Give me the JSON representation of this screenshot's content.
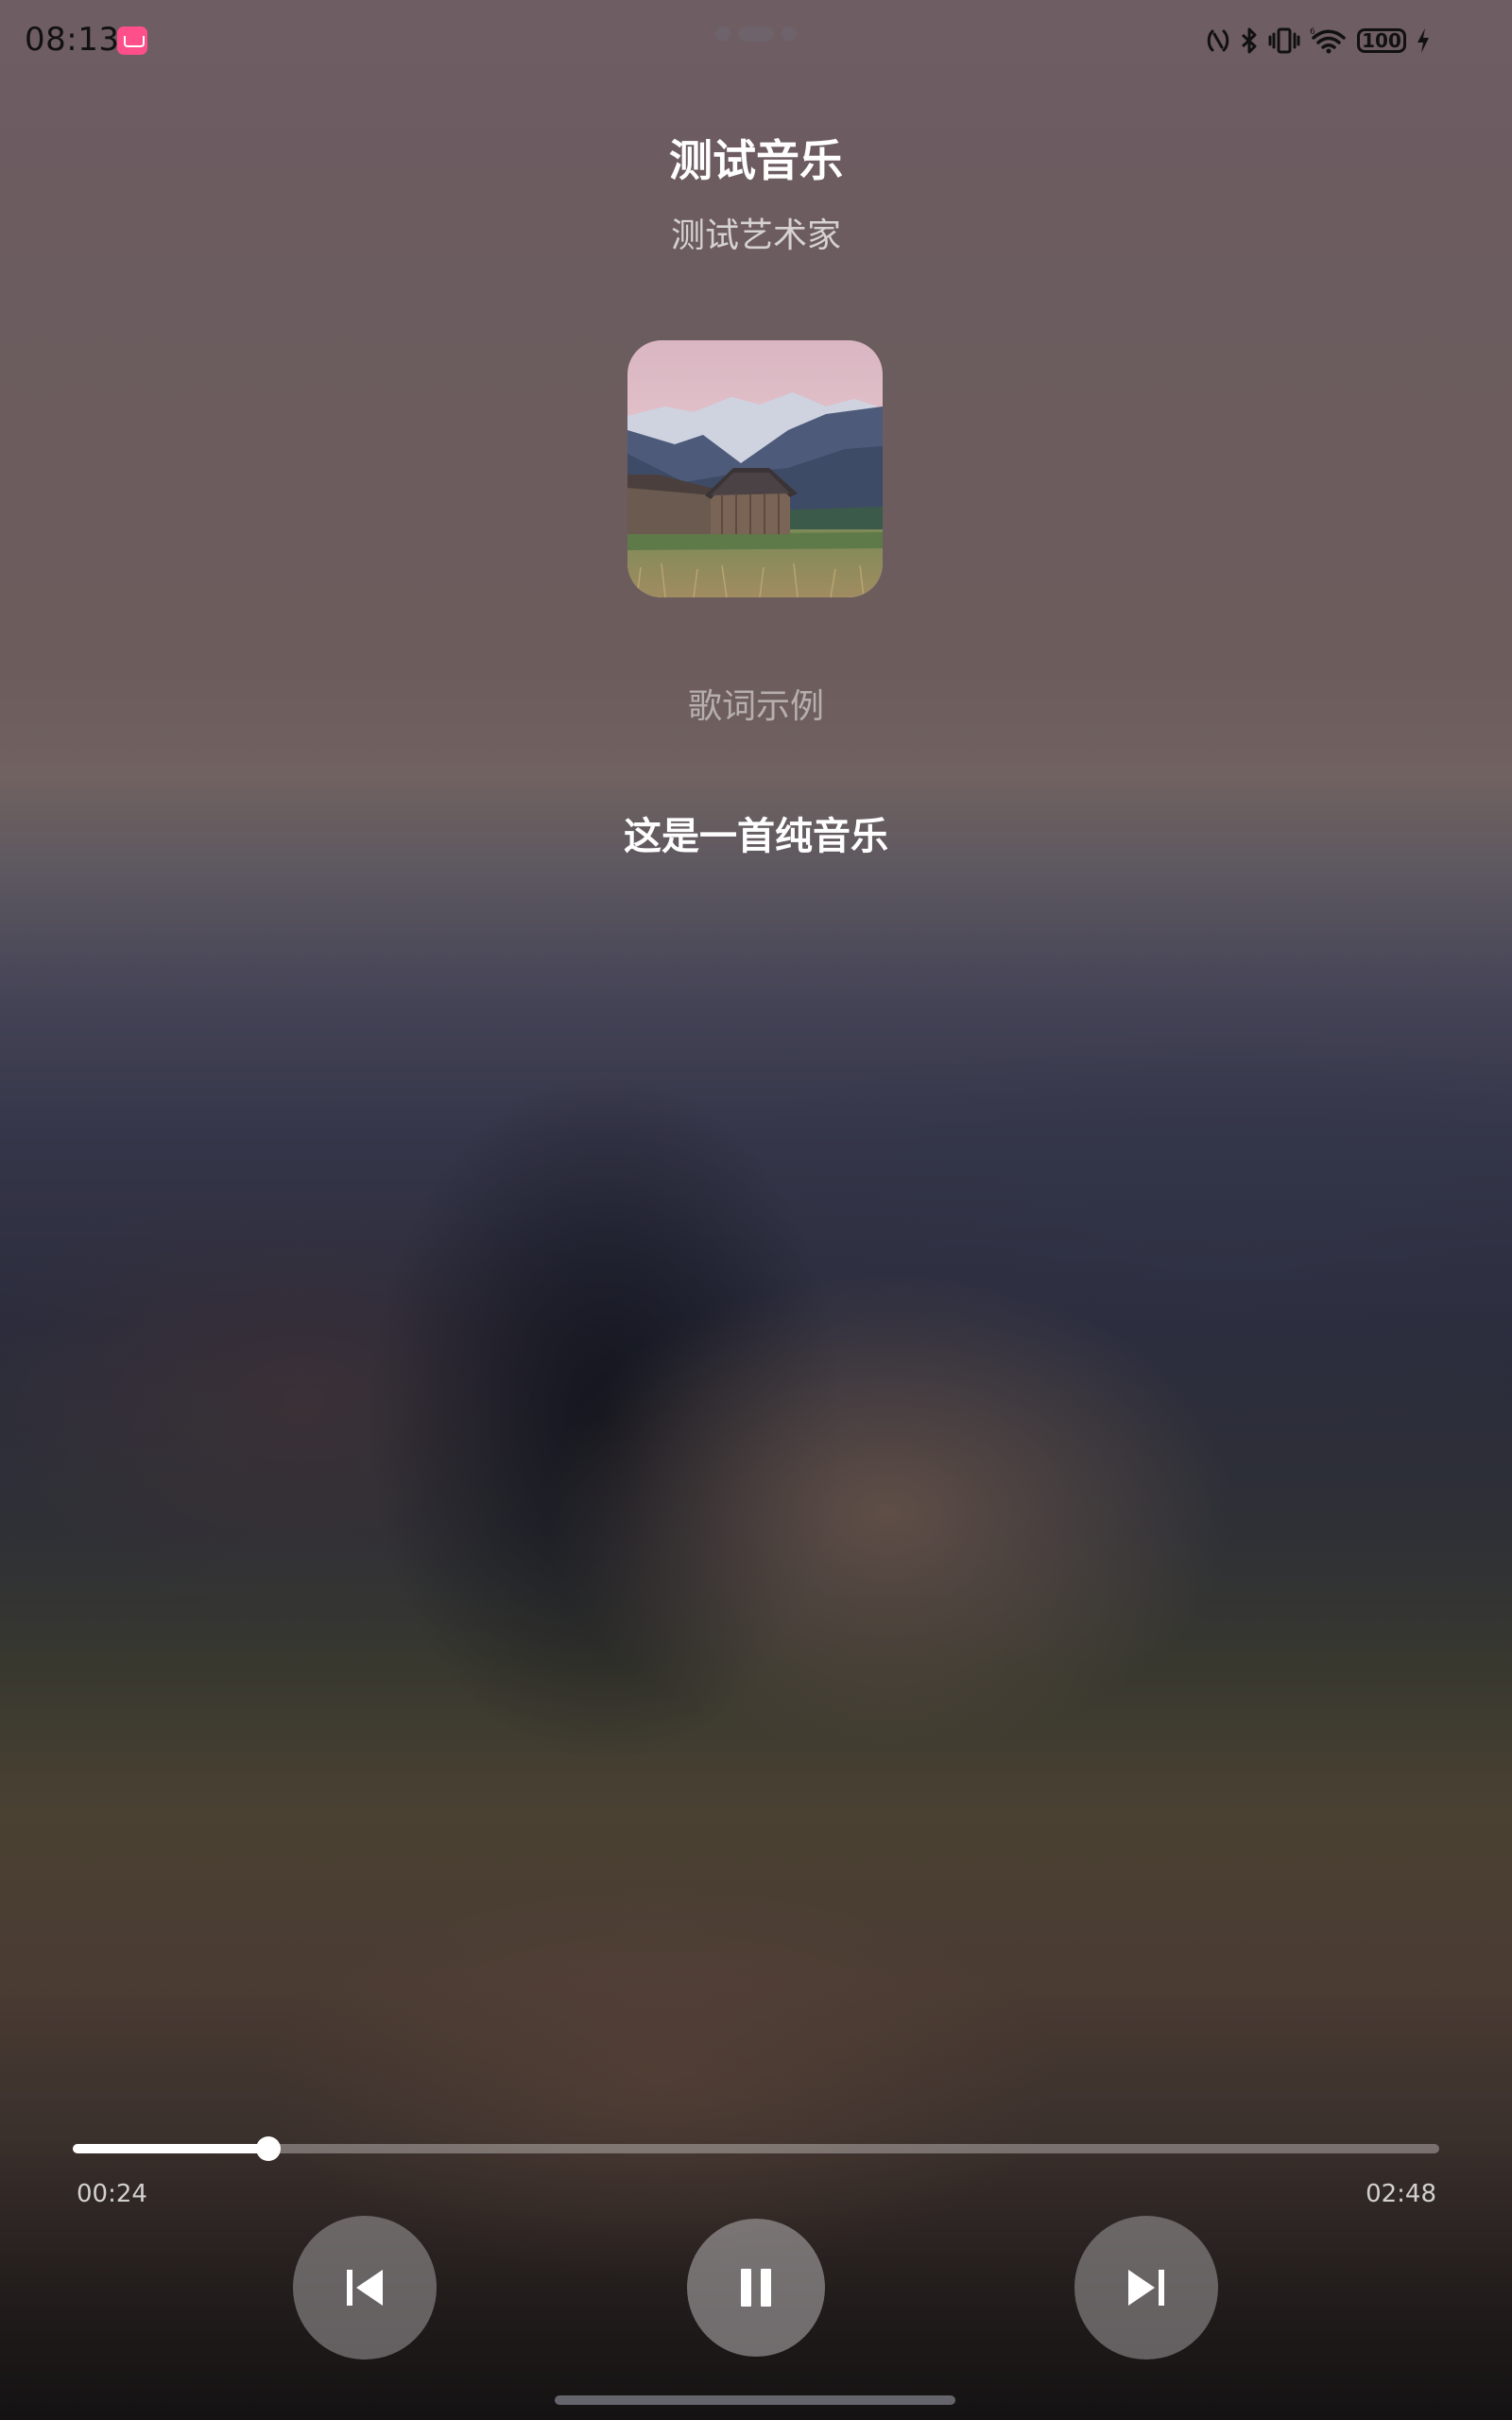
{
  "status_bar": {
    "time": "08:13",
    "app_icon": "app-badge-icon",
    "icons": [
      "nfc-icon",
      "bluetooth-icon",
      "vibrate-icon",
      "wifi-icon",
      "battery-icon",
      "charging-icon"
    ],
    "battery_level": "100"
  },
  "track": {
    "title": "测试音乐",
    "artist": "测试艺术家",
    "cover_icon": "album-cover-image"
  },
  "lyrics": {
    "sample_label": "歌词示例",
    "current_line": "这是一首纯音乐"
  },
  "playback": {
    "elapsed": "00:24",
    "total": "02:48",
    "progress_fraction": 0.143
  },
  "controls": {
    "previous_icon": "skip-previous-icon",
    "play_pause_icon": "pause-icon",
    "next_icon": "skip-next-icon"
  },
  "colors": {
    "accent": "#ffffff",
    "badge": "#ff4f8b"
  }
}
